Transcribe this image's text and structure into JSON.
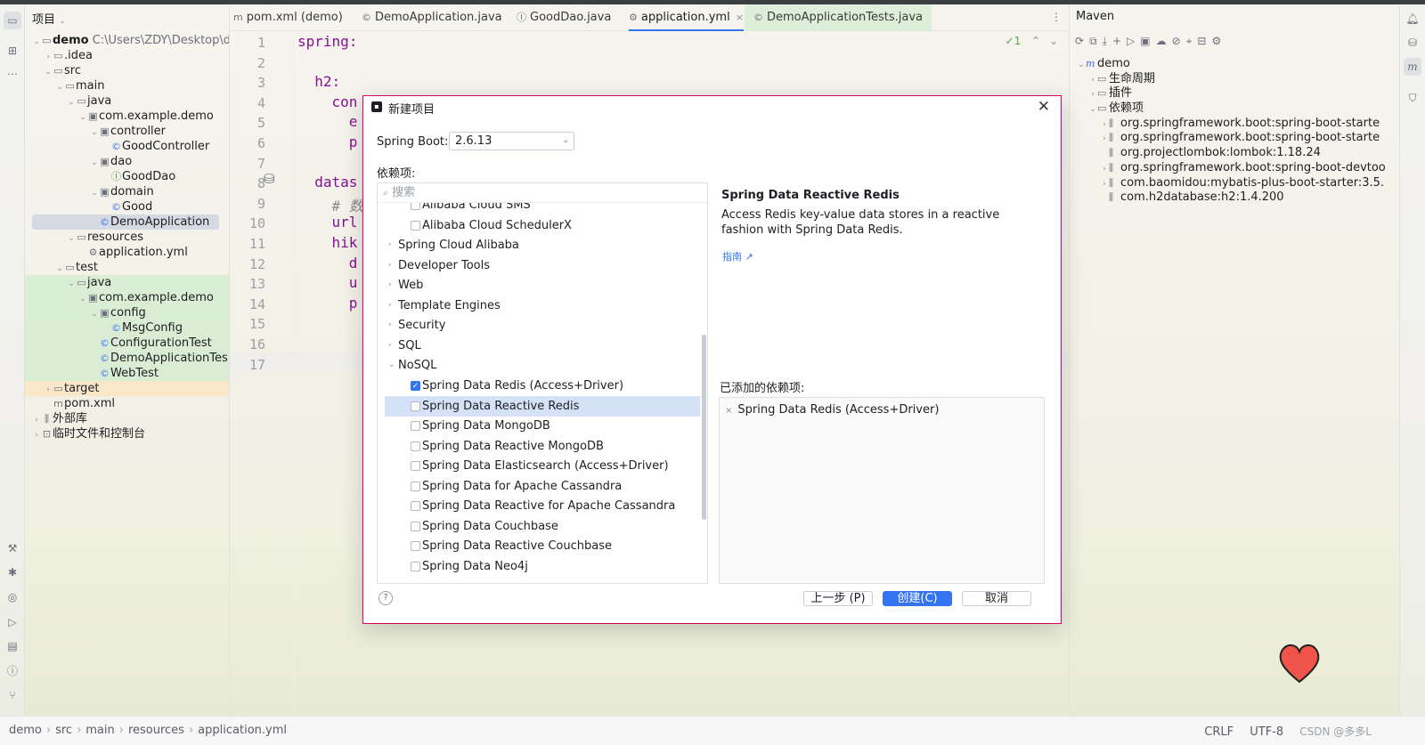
{
  "project_panel": {
    "title": "项目",
    "tree": [
      {
        "label": "demo",
        "path": "C:\\Users\\ZDY\\Desktop\\d",
        "icon": "module-icon",
        "level": 0,
        "chev": "⌄"
      },
      {
        "label": ".idea",
        "icon": "folder-icon",
        "level": 1,
        "chev": "›"
      },
      {
        "label": "src",
        "icon": "folder-icon",
        "level": 1,
        "chev": "⌄"
      },
      {
        "label": "main",
        "icon": "folder-icon",
        "level": 2,
        "chev": "⌄"
      },
      {
        "label": "java",
        "icon": "source-folder-icon",
        "level": 3,
        "chev": "⌄"
      },
      {
        "label": "com.example.demo",
        "icon": "package-icon",
        "level": 4,
        "chev": "⌄"
      },
      {
        "label": "controller",
        "icon": "package-icon",
        "level": 5,
        "chev": "⌄"
      },
      {
        "label": "GoodController",
        "icon": "class-icon",
        "level": 6
      },
      {
        "label": "dao",
        "icon": "package-icon",
        "level": 5,
        "chev": "⌄"
      },
      {
        "label": "GoodDao",
        "icon": "interface-icon",
        "level": 6
      },
      {
        "label": "domain",
        "icon": "package-icon",
        "level": 5,
        "chev": "⌄"
      },
      {
        "label": "Good",
        "icon": "class-icon",
        "level": 6
      },
      {
        "label": "DemoApplication",
        "icon": "class-icon",
        "level": 5,
        "selected": true
      },
      {
        "label": "resources",
        "icon": "resources-folder-icon",
        "level": 3,
        "chev": "⌄"
      },
      {
        "label": "application.yml",
        "icon": "yaml-file-icon",
        "level": 4
      },
      {
        "label": "test",
        "icon": "folder-icon",
        "level": 2,
        "chev": "⌄"
      },
      {
        "label": "java",
        "icon": "test-folder-icon",
        "level": 3,
        "chev": "⌄",
        "green": true
      },
      {
        "label": "com.example.demo",
        "icon": "package-icon",
        "level": 4,
        "chev": "⌄",
        "green": true
      },
      {
        "label": "config",
        "icon": "package-icon",
        "level": 5,
        "chev": "⌄",
        "green": true
      },
      {
        "label": "MsgConfig",
        "icon": "class-icon",
        "level": 6,
        "green": true
      },
      {
        "label": "ConfigurationTest",
        "icon": "class-icon",
        "level": 5,
        "green": true
      },
      {
        "label": "DemoApplicationTes",
        "icon": "class-icon",
        "level": 5,
        "green": true
      },
      {
        "label": "WebTest",
        "icon": "class-icon",
        "level": 5,
        "green": true
      },
      {
        "label": "target",
        "icon": "folder-icon",
        "level": 1,
        "chev": "›",
        "orange": true
      },
      {
        "label": "pom.xml",
        "icon": "maven-file-icon",
        "level": 1
      },
      {
        "label": "外部库",
        "icon": "library-icon",
        "level": 0,
        "chev": "›"
      },
      {
        "label": "临时文件和控制台",
        "icon": "scratch-icon",
        "level": 0,
        "chev": "›"
      }
    ]
  },
  "editor": {
    "tabs": [
      {
        "label": "pom.xml (demo)",
        "icon": "maven-file-icon"
      },
      {
        "label": "DemoApplication.java",
        "icon": "class-icon"
      },
      {
        "label": "GoodDao.java",
        "icon": "interface-icon"
      },
      {
        "label": "application.yml",
        "icon": "yaml-file-icon",
        "active": true,
        "close": "×"
      },
      {
        "label": "DemoApplicationTests.java",
        "icon": "class-icon",
        "test": true
      }
    ],
    "inspection": "✓1",
    "line_numbers": [
      "1",
      "2",
      "3",
      "4",
      "5",
      "6",
      "7",
      "8",
      "9",
      "10",
      "11",
      "12",
      "13",
      "14",
      "15",
      "16",
      "17"
    ],
    "code_lines": [
      {
        "text": "spring:",
        "kind": "key"
      },
      {
        "text": "",
        "kind": "key"
      },
      {
        "text": "  h2:",
        "kind": "key"
      },
      {
        "text": "    con",
        "kind": "key"
      },
      {
        "text": "      e",
        "kind": "key"
      },
      {
        "text": "      p",
        "kind": "key"
      },
      {
        "text": "",
        "kind": "key"
      },
      {
        "text": "  datas",
        "kind": "key"
      },
      {
        "text": "    # 数",
        "kind": "cmt"
      },
      {
        "text": "    url",
        "kind": "key"
      },
      {
        "text": "    hik",
        "kind": "key"
      },
      {
        "text": "      d",
        "kind": "key"
      },
      {
        "text": "      u",
        "kind": "key"
      },
      {
        "text": "      p",
        "kind": "key"
      },
      {
        "text": "",
        "kind": "key"
      },
      {
        "text": "",
        "kind": "key"
      },
      {
        "text": "",
        "kind": "key"
      }
    ]
  },
  "maven_panel": {
    "title": "Maven",
    "toolbar_icons": [
      "refresh-icon",
      "generate-sources-icon",
      "download-icon",
      "add-icon",
      "run-icon",
      "execute-goal-icon",
      "toggle-offline-icon",
      "skip-tests-icon",
      "show-dependencies-icon",
      "collapse-icon",
      "settings-icon"
    ],
    "tree": [
      {
        "label": "demo",
        "level": 0,
        "chev": "⌄",
        "maven": true
      },
      {
        "label": "生命周期",
        "level": 1,
        "chev": "›",
        "icon": "folder-icon"
      },
      {
        "label": "插件",
        "level": 1,
        "chev": "›",
        "icon": "folder-icon"
      },
      {
        "label": "依赖项",
        "level": 1,
        "chev": "⌄",
        "icon": "folder-icon"
      },
      {
        "label": "org.springframework.boot:spring-boot-starte",
        "level": 2,
        "chev": "›",
        "icon": "library-icon"
      },
      {
        "label": "org.springframework.boot:spring-boot-starte",
        "level": 2,
        "chev": "›",
        "icon": "library-icon"
      },
      {
        "label": "org.projectlombok:lombok:1.18.24",
        "level": 2,
        "icon": "library-icon"
      },
      {
        "label": "org.springframework.boot:spring-boot-devtoo",
        "level": 2,
        "chev": "›",
        "icon": "library-icon"
      },
      {
        "label": "com.baomidou:mybatis-plus-boot-starter:3.5.",
        "level": 2,
        "chev": "›",
        "icon": "library-icon"
      },
      {
        "label": "com.h2database:h2:1.4.200",
        "level": 2,
        "icon": "library-icon"
      }
    ]
  },
  "statusbar": {
    "breadcrumbs": [
      "demo",
      "src",
      "main",
      "resources",
      "application.yml"
    ],
    "line_ending": "CRLF",
    "encoding": "UTF-8",
    "watermark": "CSDN @多多L"
  },
  "dialog": {
    "title": "新建项目",
    "spring_boot_label": "Spring Boot:",
    "spring_boot_value": "2.6.13",
    "dependencies_label": "依赖项:",
    "search_placeholder": "搜索",
    "dependency_rows": [
      {
        "label": "Alibaba Cloud SMS",
        "type": "item",
        "checked": false
      },
      {
        "label": "Alibaba Cloud SchedulerX",
        "type": "item",
        "checked": false
      },
      {
        "label": "Spring Cloud Alibaba",
        "type": "group",
        "expanded": false
      },
      {
        "label": "Developer Tools",
        "type": "group",
        "expanded": false
      },
      {
        "label": "Web",
        "type": "group",
        "expanded": false
      },
      {
        "label": "Template Engines",
        "type": "group",
        "expanded": false
      },
      {
        "label": "Security",
        "type": "group",
        "expanded": false
      },
      {
        "label": "SQL",
        "type": "group",
        "expanded": false
      },
      {
        "label": "NoSQL",
        "type": "group",
        "expanded": true
      },
      {
        "label": "Spring Data Redis (Access+Driver)",
        "type": "item",
        "checked": true
      },
      {
        "label": "Spring Data Reactive Redis",
        "type": "item",
        "checked": false,
        "selected": true
      },
      {
        "label": "Spring Data MongoDB",
        "type": "item",
        "checked": false
      },
      {
        "label": "Spring Data Reactive MongoDB",
        "type": "item",
        "checked": false
      },
      {
        "label": "Spring Data Elasticsearch (Access+Driver)",
        "type": "item",
        "checked": false
      },
      {
        "label": "Spring Data for Apache Cassandra",
        "type": "item",
        "checked": false
      },
      {
        "label": "Spring Data Reactive for Apache Cassandra",
        "type": "item",
        "checked": false
      },
      {
        "label": "Spring Data Couchbase",
        "type": "item",
        "checked": false
      },
      {
        "label": "Spring Data Reactive Couchbase",
        "type": "item",
        "checked": false
      },
      {
        "label": "Spring Data Neo4j",
        "type": "item",
        "checked": false
      }
    ],
    "description_title": "Spring Data Reactive Redis",
    "description_text": "Access Redis key-value data stores in a reactive fashion with Spring Data Redis.",
    "guide_link": "指南 ↗",
    "added_label": "已添加的依赖项:",
    "added_items": [
      "Spring Data Redis (Access+Driver)"
    ],
    "help": "?",
    "prev_button": "上一步 (P)",
    "create_button": "创建(C)",
    "cancel_button": "取消"
  }
}
